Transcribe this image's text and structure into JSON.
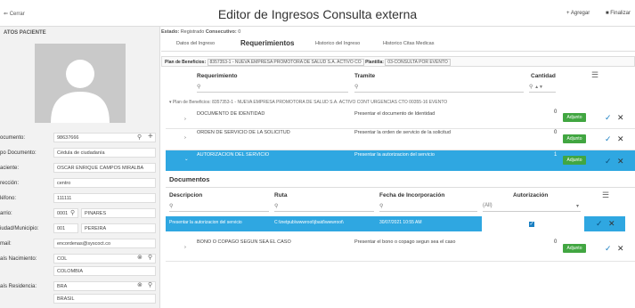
{
  "window": {
    "title": "Editor de Ingresos Consulta externa",
    "close_label": "Cerrar",
    "add_label": "Agregar",
    "finish_label": "Finalizar"
  },
  "patient": {
    "section_title": "ATOS PACIENTE",
    "fields": [
      {
        "label": "ocumento:",
        "value": "98637666"
      },
      {
        "label": "po Documento:",
        "value": "Cédula de ciudadanía"
      },
      {
        "label": "aciente:",
        "value": "OSCAR ENRIQUE CAMPOS MIRALBA"
      },
      {
        "label": "rección:",
        "value": "centro"
      },
      {
        "label": "léfono:",
        "value": "111111"
      },
      {
        "label": "arrio:",
        "value": "0001",
        "value2": "PINARES"
      },
      {
        "label": "iudad/Municipio:",
        "value": "001",
        "value2": "PEREIRA"
      },
      {
        "label": "mail:",
        "value": "encordenas@syscoct.co"
      },
      {
        "label": "aís Nacimiento:",
        "value": "COL",
        "value2": "COLOMBIA"
      },
      {
        "label": "aís Residencia:",
        "value": "BRA",
        "value2": "BRASIL"
      }
    ]
  },
  "status": {
    "estado_label": "Estado:",
    "estado_value": "Registrado",
    "consecutivo_label": "Consecutivo:",
    "consecutivo_value": "0"
  },
  "tabs": [
    {
      "label": "Datos del Ingreso"
    },
    {
      "label": "Requerimientos"
    },
    {
      "label": "Historico del Ingreso"
    },
    {
      "label": "Historico Citas Medicas"
    }
  ],
  "plan": {
    "plan_label": "Plan de Beneficios:",
    "plan_value": "8357353-1 - NUEVA EMPRESA PROMOTORA DE SALUD S.A. ACTIVO CO",
    "plantilla_label": "Plantilla:",
    "plantilla_value": "03-CONSULTA POR EVENTO"
  },
  "req_grid": {
    "columns": [
      "Requerimiento",
      "Tramite",
      "Cantidad"
    ],
    "group_label": "Plan de Beneficios: 8357353-1 - NUEVA EMPRESA PROMOTORA DE SALUD S.A. ACTIVO CONT URGENCIAS CTO 00355-16 EVENTO",
    "rows": [
      {
        "req": "DOCUMENTO DE IDENTIDAD",
        "tramite": "Presentar el documento de Identidad",
        "qty": "0",
        "action": "Adjunto"
      },
      {
        "req": "ORDEN DE SERVICIO DE LA SOLICITUD",
        "tramite": "Presentar la orden de servicio de la solicitud",
        "qty": "0",
        "action": "Adjunto"
      },
      {
        "req": "AUTORIZACION DEL SERVICIO",
        "tramite": "Presentar la autorizacion del servicio",
        "qty": "1",
        "action": "Adjunto"
      },
      {
        "req": "BONO O COPAGO SEGUN SEA EL CASO",
        "tramite": "Presentar el bono o copago segun sea el caso",
        "qty": "0",
        "action": "Adjunto"
      }
    ]
  },
  "documents": {
    "tab_label": "Documentos",
    "columns": [
      "Descripcion",
      "Ruta",
      "Fecha de Incorporación",
      "Autorización"
    ],
    "filter_select": "(All)",
    "row": {
      "descripcion": "Presentar la autorizacion del servicio",
      "ruta": "C:\\inetpub\\wwwroot\\jbaid\\wwwroot\\",
      "fecha": "30/07/2021 10:55 AM",
      "autorizacion": true
    }
  },
  "colors": {
    "selection": "#2fa7e1",
    "accent_blue": "#1a7fc2",
    "adjunto_green": "#41a641"
  }
}
